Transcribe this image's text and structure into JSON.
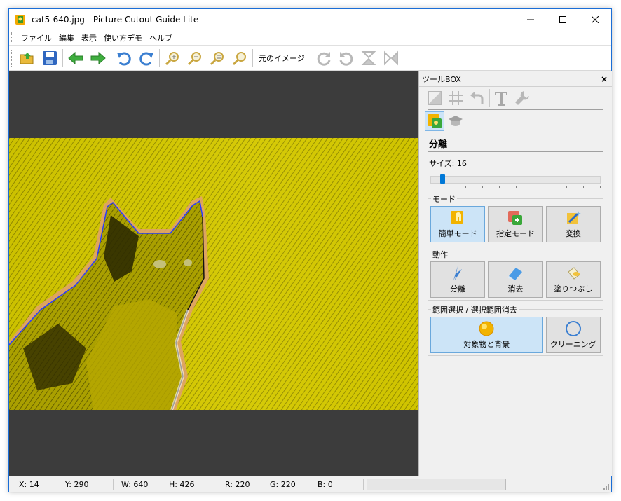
{
  "window": {
    "title": "cat5-640.jpg - Picture Cutout Guide Lite"
  },
  "menu": [
    "ファイル",
    "編集",
    "表示",
    "使い方デモ",
    "ヘルプ"
  ],
  "toolbar": {
    "original_image_label": "元のイメージ"
  },
  "toolbox": {
    "title": "ツールBOX",
    "close": "×",
    "section_title": "分離",
    "size_label": "サイズ: 16",
    "size_value": 16,
    "mode": {
      "label": "モード",
      "buttons": [
        "簡単モード",
        "指定モード",
        "変換"
      ]
    },
    "action": {
      "label": "動作",
      "buttons": [
        "分離",
        "消去",
        "塗りつぶし"
      ]
    },
    "range": {
      "label": "範囲選択 / 選択範囲消去",
      "buttons": [
        "対象物と背景",
        "クリーニング"
      ]
    }
  },
  "status": {
    "x": "X: 14",
    "y": "Y: 290",
    "w": "W: 640",
    "h": "H: 426",
    "r": "R: 220",
    "g": "G: 220",
    "b": "B: 0"
  },
  "colors": {
    "accent": "#0078d7",
    "canvas_bg": "#3c3c3c",
    "photo_bg": "#c8c000"
  }
}
